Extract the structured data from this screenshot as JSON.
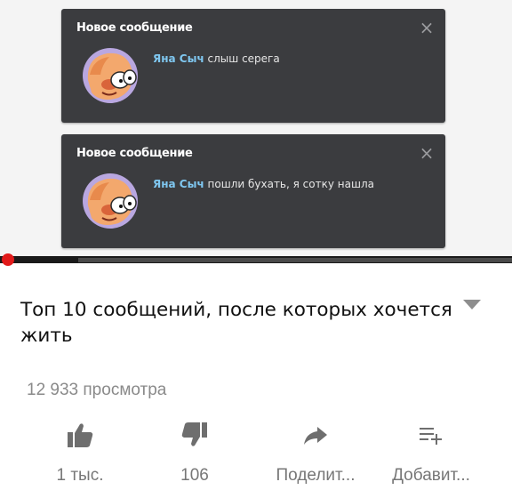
{
  "notifications": [
    {
      "title": "Новое сообщение",
      "close": "×",
      "icon": "close-icon",
      "sender": "Яна Сыч",
      "text": "слыш серега"
    },
    {
      "title": "Новое сообщение",
      "close": "×",
      "icon": "close-icon",
      "sender": "Яна Сыч",
      "text": "пошли бухать, я сотку нашла"
    }
  ],
  "player": {
    "progress_fraction": 0.01,
    "accent_color": "#e11a1a"
  },
  "video": {
    "title": "Топ 10 сообщений, после которых хочется жить",
    "views": "12 933 просмотра"
  },
  "actions": {
    "like": {
      "label": "1 тыс.",
      "icon": "thumbs-up-icon"
    },
    "dislike": {
      "label": "106",
      "icon": "thumbs-down-icon"
    },
    "share": {
      "label": "Поделит...",
      "icon": "share-icon"
    },
    "add": {
      "label": "Добавит...",
      "icon": "add-to-playlist-icon"
    }
  }
}
